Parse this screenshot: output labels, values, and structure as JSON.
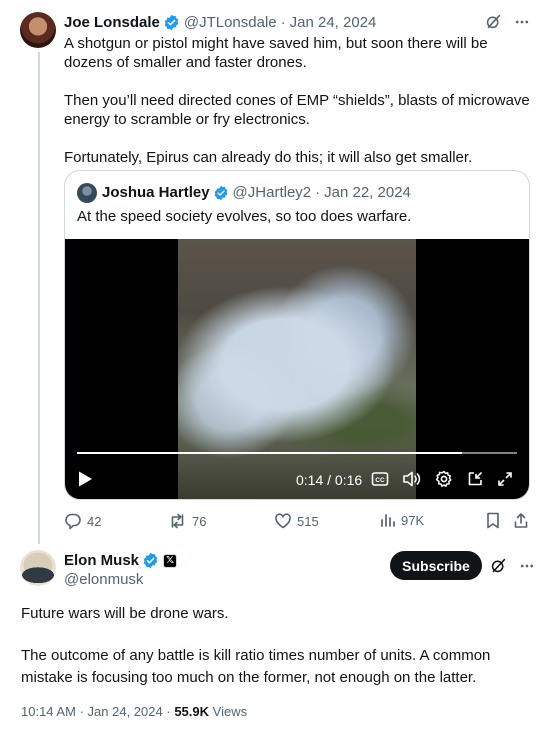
{
  "parent_tweet": {
    "author_name": "Joe Lonsdale",
    "handle": "@JTLonsdale",
    "separator": "·",
    "date": "Jan 24, 2024",
    "paragraphs": [
      "A shotgun or pistol might have saved him, but soon there will be dozens of smaller and faster drones.",
      "Then you’ll need directed cones of EMP “shields”, blasts of microwave energy to scramble or fry electronics.",
      "Fortunately, Epirus can already do this; it will also get smaller."
    ],
    "quoted_tweet": {
      "author_name": "Joshua Hartley",
      "handle": "@JHartley2",
      "date": "Jan 22, 2024",
      "text": "At the speed society evolves, so too does warfare.",
      "video": {
        "time_display": "0:14 / 0:16",
        "progress": 0.875
      }
    },
    "stats": {
      "replies": "42",
      "reposts": "76",
      "likes": "515",
      "views": "97K"
    }
  },
  "main_tweet": {
    "author_name": "Elon Musk",
    "affiliate_badge": "𝕏",
    "handle": "@elonmusk",
    "subscribe_label": "Subscribe",
    "paragraphs": [
      "Future wars will be drone wars.",
      "The outcome of any battle is kill ratio times number of units. A common mistake is focusing too much on the former, not enough on the latter."
    ],
    "time": "10:14 AM",
    "separator": "·",
    "date": "Jan 24, 2024",
    "view_count": "55.9K",
    "view_label": "Views"
  },
  "colors": {
    "verified_blue": "#1d9bf0",
    "muted_text": "#536471",
    "primary_text": "#0f1419",
    "border": "#cfd9de"
  }
}
